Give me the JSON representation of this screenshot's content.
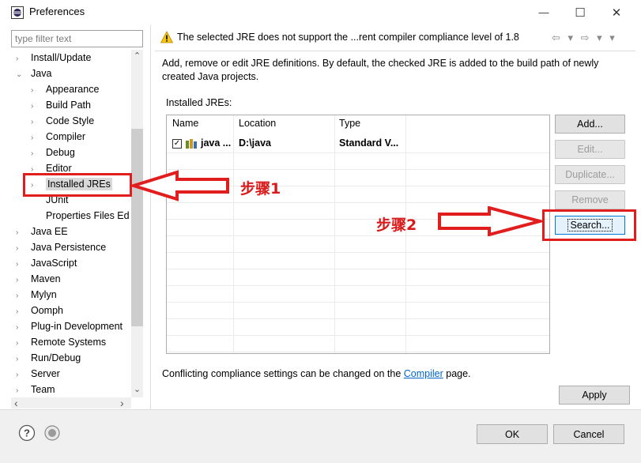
{
  "window": {
    "title": "Preferences",
    "minimize_glyph": "—",
    "maximize_glyph": "☐",
    "close_glyph": "✕"
  },
  "filter": {
    "placeholder": "type filter text"
  },
  "tree": {
    "items": [
      {
        "label": "Install/Update",
        "level": 0,
        "expander": "›"
      },
      {
        "label": "Java",
        "level": 0,
        "expander": "⌄"
      },
      {
        "label": "Appearance",
        "level": 1,
        "expander": "›"
      },
      {
        "label": "Build Path",
        "level": 1,
        "expander": "›"
      },
      {
        "label": "Code Style",
        "level": 1,
        "expander": "›"
      },
      {
        "label": "Compiler",
        "level": 1,
        "expander": "›"
      },
      {
        "label": "Debug",
        "level": 1,
        "expander": "›"
      },
      {
        "label": "Editor",
        "level": 1,
        "expander": "›"
      },
      {
        "label": "Installed JREs",
        "level": 1,
        "expander": "›",
        "selected": true
      },
      {
        "label": "JUnit",
        "level": 1,
        "expander": ""
      },
      {
        "label": "Properties Files Ed",
        "level": 1,
        "expander": ""
      },
      {
        "label": "Java EE",
        "level": 0,
        "expander": "›"
      },
      {
        "label": "Java Persistence",
        "level": 0,
        "expander": "›"
      },
      {
        "label": "JavaScript",
        "level": 0,
        "expander": "›"
      },
      {
        "label": "Maven",
        "level": 0,
        "expander": "›"
      },
      {
        "label": "Mylyn",
        "level": 0,
        "expander": "›"
      },
      {
        "label": "Oomph",
        "level": 0,
        "expander": "›"
      },
      {
        "label": "Plug-in Development",
        "level": 0,
        "expander": "›"
      },
      {
        "label": "Remote Systems",
        "level": 0,
        "expander": "›"
      },
      {
        "label": "Run/Debug",
        "level": 0,
        "expander": "›"
      },
      {
        "label": "Server",
        "level": 0,
        "expander": "›"
      },
      {
        "label": "Team",
        "level": 0,
        "expander": "›"
      }
    ]
  },
  "message": {
    "text": "The selected JRE does not support the ...rent compiler compliance level of 1.8",
    "nav": "⇦ ▾ ⇨ ▾ ▾"
  },
  "description": "Add, remove or edit JRE definitions. By default, the checked JRE is added to the build path of newly created Java projects.",
  "installed_label": "Installed JREs:",
  "table": {
    "columns": [
      "Name",
      "Location",
      "Type"
    ],
    "rows": [
      {
        "checked": true,
        "check_glyph": "✓",
        "name": "java ...",
        "location": "D:\\java",
        "type": "Standard V..."
      }
    ]
  },
  "buttons": {
    "add": "Add...",
    "edit": "Edit...",
    "duplicate": "Duplicate...",
    "remove": "Remove",
    "search": "Search...",
    "apply": "Apply",
    "ok": "OK",
    "cancel": "Cancel"
  },
  "conflict": {
    "prefix": "Conflicting compliance settings can be changed on the ",
    "link": "Compiler",
    "suffix": " page."
  },
  "scroll": {
    "up": "⌃",
    "down": "⌄",
    "left": "‹",
    "right": "›"
  },
  "annotations": {
    "step1": "步骤1",
    "step2": "步骤2",
    "color": "#e21d1d"
  }
}
